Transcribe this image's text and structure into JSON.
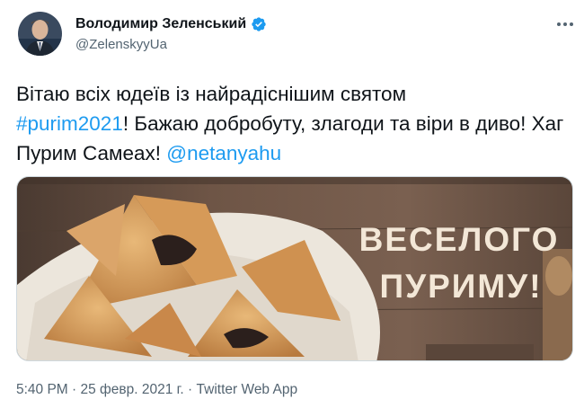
{
  "tweet": {
    "author_name": "Володимир Зеленський",
    "author_handle": "@ZelenskyyUa",
    "text_1": "Вітаю всіх юдеїв із найрадіснішим святом",
    "hashtag": "#purim2021",
    "text_2": "! Бажаю добробуту, злагоди та віри в диво! Хаг Пурим Самеах! ",
    "mention": "@netanyahu",
    "media_caption_line1": "ВЕСЕЛОГО",
    "media_caption_line2": "ПУРИМУ!",
    "timestamp": "5:40 PM · 25 февр. 2021 г. · Twitter Web App"
  },
  "colors": {
    "link": "#1d9bf0",
    "verified_badge": "#1d9bf0",
    "secondary_text": "#536471",
    "wood_background": "#6e5546",
    "caption_text": "#f3e7d7"
  },
  "icons": [
    "verified-badge-icon",
    "more-options-icon"
  ]
}
